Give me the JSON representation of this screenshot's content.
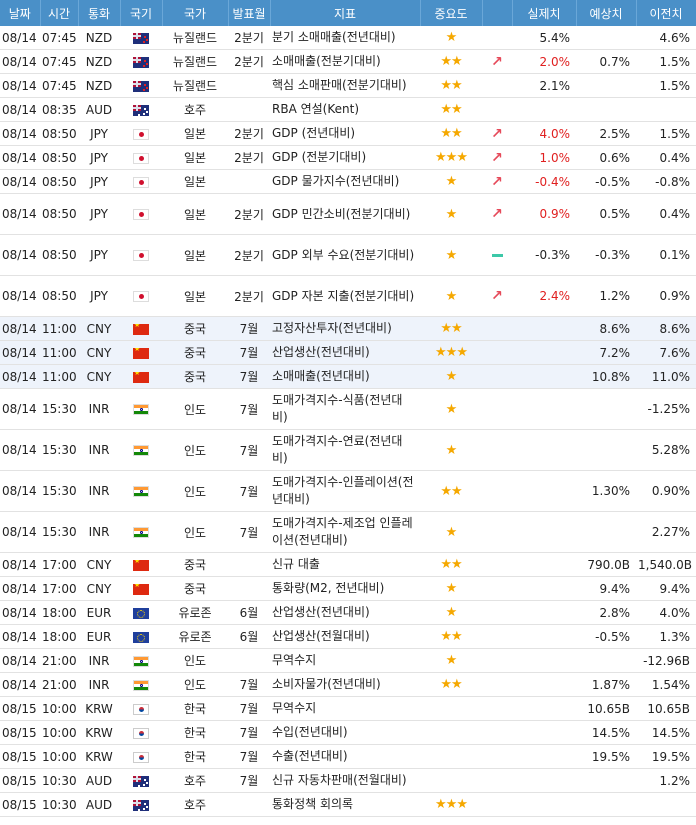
{
  "headers": [
    "날짜",
    "시간",
    "통화",
    "국기",
    "국가",
    "발표월",
    "지표",
    "중요도",
    "",
    "실제치",
    "예상치",
    "이전치"
  ],
  "rows": [
    {
      "date": "08/14",
      "time": "07:45",
      "cur": "NZD",
      "flag": "nz-flag",
      "country": "뉴질랜드",
      "period": "2분기",
      "ind": "분기 소매매출(전년대비)",
      "imp": "★",
      "dir": "",
      "actual": "5.4%",
      "forecast": "",
      "prev": "4.6%",
      "red": false,
      "hl": false,
      "tall": false
    },
    {
      "date": "08/14",
      "time": "07:45",
      "cur": "NZD",
      "flag": "nz-flag",
      "country": "뉴질랜드",
      "period": "2분기",
      "ind": "소매매출(전분기대비)",
      "imp": "★★",
      "dir": "up",
      "actual": "2.0%",
      "forecast": "0.7%",
      "prev": "1.5%",
      "red": true,
      "hl": false,
      "tall": false
    },
    {
      "date": "08/14",
      "time": "07:45",
      "cur": "NZD",
      "flag": "nz-flag",
      "country": "뉴질랜드",
      "period": "",
      "ind": "핵심 소매판매(전분기대비)",
      "imp": "★★",
      "dir": "",
      "actual": "2.1%",
      "forecast": "",
      "prev": "1.5%",
      "red": false,
      "hl": false,
      "tall": false
    },
    {
      "date": "08/14",
      "time": "08:35",
      "cur": "AUD",
      "flag": "au-flag",
      "country": "호주",
      "period": "",
      "ind": "RBA 연설(Kent)",
      "imp": "★★",
      "dir": "",
      "actual": "",
      "forecast": "",
      "prev": "",
      "red": false,
      "hl": false,
      "tall": false
    },
    {
      "date": "08/14",
      "time": "08:50",
      "cur": "JPY",
      "flag": "jp-flag",
      "country": "일본",
      "period": "2분기",
      "ind": "GDP (전년대비)",
      "imp": "★★",
      "dir": "up",
      "actual": "4.0%",
      "forecast": "2.5%",
      "prev": "1.5%",
      "red": true,
      "hl": false,
      "tall": false
    },
    {
      "date": "08/14",
      "time": "08:50",
      "cur": "JPY",
      "flag": "jp-flag",
      "country": "일본",
      "period": "2분기",
      "ind": "GDP (전분기대비)",
      "imp": "★★★",
      "dir": "up",
      "actual": "1.0%",
      "forecast": "0.6%",
      "prev": "0.4%",
      "red": true,
      "hl": false,
      "tall": false
    },
    {
      "date": "08/14",
      "time": "08:50",
      "cur": "JPY",
      "flag": "jp-flag",
      "country": "일본",
      "period": "",
      "ind": "GDP 물가지수(전년대비)",
      "imp": "★",
      "dir": "up",
      "actual": "-0.4%",
      "forecast": "-0.5%",
      "prev": "-0.8%",
      "red": true,
      "hl": false,
      "tall": false
    },
    {
      "date": "08/14",
      "time": "08:50",
      "cur": "JPY",
      "flag": "jp-flag",
      "country": "일본",
      "period": "2분기",
      "ind": "GDP 민간소비(전분기대비)",
      "imp": "★",
      "dir": "up",
      "actual": "0.9%",
      "forecast": "0.5%",
      "prev": "0.4%",
      "red": true,
      "hl": false,
      "tall": true
    },
    {
      "date": "08/14",
      "time": "08:50",
      "cur": "JPY",
      "flag": "jp-flag",
      "country": "일본",
      "period": "2분기",
      "ind": "GDP 외부 수요(전분기대비)",
      "imp": "★",
      "dir": "flat",
      "actual": "-0.3%",
      "forecast": "-0.3%",
      "prev": "0.1%",
      "red": false,
      "hl": false,
      "tall": true
    },
    {
      "date": "08/14",
      "time": "08:50",
      "cur": "JPY",
      "flag": "jp-flag",
      "country": "일본",
      "period": "2분기",
      "ind": "GDP 자본 지출(전분기대비)",
      "imp": "★",
      "dir": "up",
      "actual": "2.4%",
      "forecast": "1.2%",
      "prev": "0.9%",
      "red": true,
      "hl": false,
      "tall": true
    },
    {
      "date": "08/14",
      "time": "11:00",
      "cur": "CNY",
      "flag": "cn-flag",
      "country": "중국",
      "period": "7월",
      "ind": "고정자산투자(전년대비)",
      "imp": "★★",
      "dir": "",
      "actual": "",
      "forecast": "8.6%",
      "prev": "8.6%",
      "red": false,
      "hl": true,
      "tall": false
    },
    {
      "date": "08/14",
      "time": "11:00",
      "cur": "CNY",
      "flag": "cn-flag",
      "country": "중국",
      "period": "7월",
      "ind": "산업생산(전년대비)",
      "imp": "★★★",
      "dir": "",
      "actual": "",
      "forecast": "7.2%",
      "prev": "7.6%",
      "red": false,
      "hl": true,
      "tall": false
    },
    {
      "date": "08/14",
      "time": "11:00",
      "cur": "CNY",
      "flag": "cn-flag",
      "country": "중국",
      "period": "7월",
      "ind": "소매매출(전년대비)",
      "imp": "★",
      "dir": "",
      "actual": "",
      "forecast": "10.8%",
      "prev": "11.0%",
      "red": false,
      "hl": true,
      "tall": false
    },
    {
      "date": "08/14",
      "time": "15:30",
      "cur": "INR",
      "flag": "in-flag",
      "country": "인도",
      "period": "7월",
      "ind": "도매가격지수-식품(전년대비)",
      "imp": "★",
      "dir": "",
      "actual": "",
      "forecast": "",
      "prev": "-1.25%",
      "red": false,
      "hl": false,
      "tall": true
    },
    {
      "date": "08/14",
      "time": "15:30",
      "cur": "INR",
      "flag": "in-flag",
      "country": "인도",
      "period": "7월",
      "ind": "도매가격지수-연료(전년대비)",
      "imp": "★",
      "dir": "",
      "actual": "",
      "forecast": "",
      "prev": "5.28%",
      "red": false,
      "hl": false,
      "tall": true
    },
    {
      "date": "08/14",
      "time": "15:30",
      "cur": "INR",
      "flag": "in-flag",
      "country": "인도",
      "period": "7월",
      "ind": "도매가격지수-인플레이션(전년대비)",
      "imp": "★★",
      "dir": "",
      "actual": "",
      "forecast": "1.30%",
      "prev": "0.90%",
      "red": false,
      "hl": false,
      "tall": true
    },
    {
      "date": "08/14",
      "time": "15:30",
      "cur": "INR",
      "flag": "in-flag",
      "country": "인도",
      "period": "7월",
      "ind": "도매가격지수-제조업 인플레이션(전년대비)",
      "imp": "★",
      "dir": "",
      "actual": "",
      "forecast": "",
      "prev": "2.27%",
      "red": false,
      "hl": false,
      "tall": true
    },
    {
      "date": "08/14",
      "time": "17:00",
      "cur": "CNY",
      "flag": "cn-flag",
      "country": "중국",
      "period": "",
      "ind": "신규 대출",
      "imp": "★★",
      "dir": "",
      "actual": "",
      "forecast": "790.0B",
      "prev": "1,540.0B",
      "red": false,
      "hl": false,
      "tall": false
    },
    {
      "date": "08/14",
      "time": "17:00",
      "cur": "CNY",
      "flag": "cn-flag",
      "country": "중국",
      "period": "",
      "ind": "통화량(M2, 전년대비)",
      "imp": "★",
      "dir": "",
      "actual": "",
      "forecast": "9.4%",
      "prev": "9.4%",
      "red": false,
      "hl": false,
      "tall": false
    },
    {
      "date": "08/14",
      "time": "18:00",
      "cur": "EUR",
      "flag": "eu-flag",
      "country": "유로존",
      "period": "6월",
      "ind": "산업생산(전년대비)",
      "imp": "★",
      "dir": "",
      "actual": "",
      "forecast": "2.8%",
      "prev": "4.0%",
      "red": false,
      "hl": false,
      "tall": false
    },
    {
      "date": "08/14",
      "time": "18:00",
      "cur": "EUR",
      "flag": "eu-flag",
      "country": "유로존",
      "period": "6월",
      "ind": "산업생산(전월대비)",
      "imp": "★★",
      "dir": "",
      "actual": "",
      "forecast": "-0.5%",
      "prev": "1.3%",
      "red": false,
      "hl": false,
      "tall": false
    },
    {
      "date": "08/14",
      "time": "21:00",
      "cur": "INR",
      "flag": "in-flag",
      "country": "인도",
      "period": "",
      "ind": "무역수지",
      "imp": "★",
      "dir": "",
      "actual": "",
      "forecast": "",
      "prev": "-12.96B",
      "red": false,
      "hl": false,
      "tall": false
    },
    {
      "date": "08/14",
      "time": "21:00",
      "cur": "INR",
      "flag": "in-flag",
      "country": "인도",
      "period": "7월",
      "ind": "소비자물가(전년대비)",
      "imp": "★★",
      "dir": "",
      "actual": "",
      "forecast": "1.87%",
      "prev": "1.54%",
      "red": false,
      "hl": false,
      "tall": false
    },
    {
      "date": "08/15",
      "time": "10:00",
      "cur": "KRW",
      "flag": "kr-flag",
      "country": "한국",
      "period": "7월",
      "ind": "무역수지",
      "imp": "",
      "dir": "",
      "actual": "",
      "forecast": "10.65B",
      "prev": "10.65B",
      "red": false,
      "hl": false,
      "tall": false
    },
    {
      "date": "08/15",
      "time": "10:00",
      "cur": "KRW",
      "flag": "kr-flag",
      "country": "한국",
      "period": "7월",
      "ind": "수입(전년대비)",
      "imp": "",
      "dir": "",
      "actual": "",
      "forecast": "14.5%",
      "prev": "14.5%",
      "red": false,
      "hl": false,
      "tall": false
    },
    {
      "date": "08/15",
      "time": "10:00",
      "cur": "KRW",
      "flag": "kr-flag",
      "country": "한국",
      "period": "7월",
      "ind": "수출(전년대비)",
      "imp": "",
      "dir": "",
      "actual": "",
      "forecast": "19.5%",
      "prev": "19.5%",
      "red": false,
      "hl": false,
      "tall": false
    },
    {
      "date": "08/15",
      "time": "10:30",
      "cur": "AUD",
      "flag": "au-flag",
      "country": "호주",
      "period": "7월",
      "ind": "신규 자동차판매(전월대비)",
      "imp": "",
      "dir": "",
      "actual": "",
      "forecast": "",
      "prev": "1.2%",
      "red": false,
      "hl": false,
      "tall": false
    },
    {
      "date": "08/15",
      "time": "10:30",
      "cur": "AUD",
      "flag": "au-flag",
      "country": "호주",
      "period": "",
      "ind": "통화정책 회의록",
      "imp": "★★★",
      "dir": "",
      "actual": "",
      "forecast": "",
      "prev": "",
      "red": false,
      "hl": false,
      "tall": false
    }
  ]
}
